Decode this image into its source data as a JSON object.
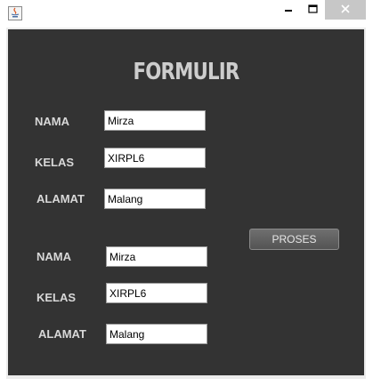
{
  "form": {
    "title": "FORMULIR",
    "process_button": "PROSES",
    "inputs": [
      {
        "nama_label": "NAMA",
        "nama_value": "Mirza",
        "kelas_label": "KELAS",
        "kelas_value": "XIRPL6",
        "alamat_label": "ALAMAT",
        "alamat_value": "Malang"
      }
    ],
    "outputs": [
      {
        "nama_label": "NAMA",
        "nama_value": "Mirza",
        "kelas_label": "KELAS",
        "kelas_value": "XIRPL6",
        "alamat_label": "ALAMAT",
        "alamat_value": "Malang"
      }
    ]
  },
  "icons": {
    "app": "java-icon",
    "minimize": "minimize-icon",
    "maximize": "maximize-icon",
    "close": "close-icon"
  },
  "colors": {
    "background": "#333333",
    "label": "#d8d8d8",
    "title": "#cdcdcd",
    "button": "#606060"
  }
}
